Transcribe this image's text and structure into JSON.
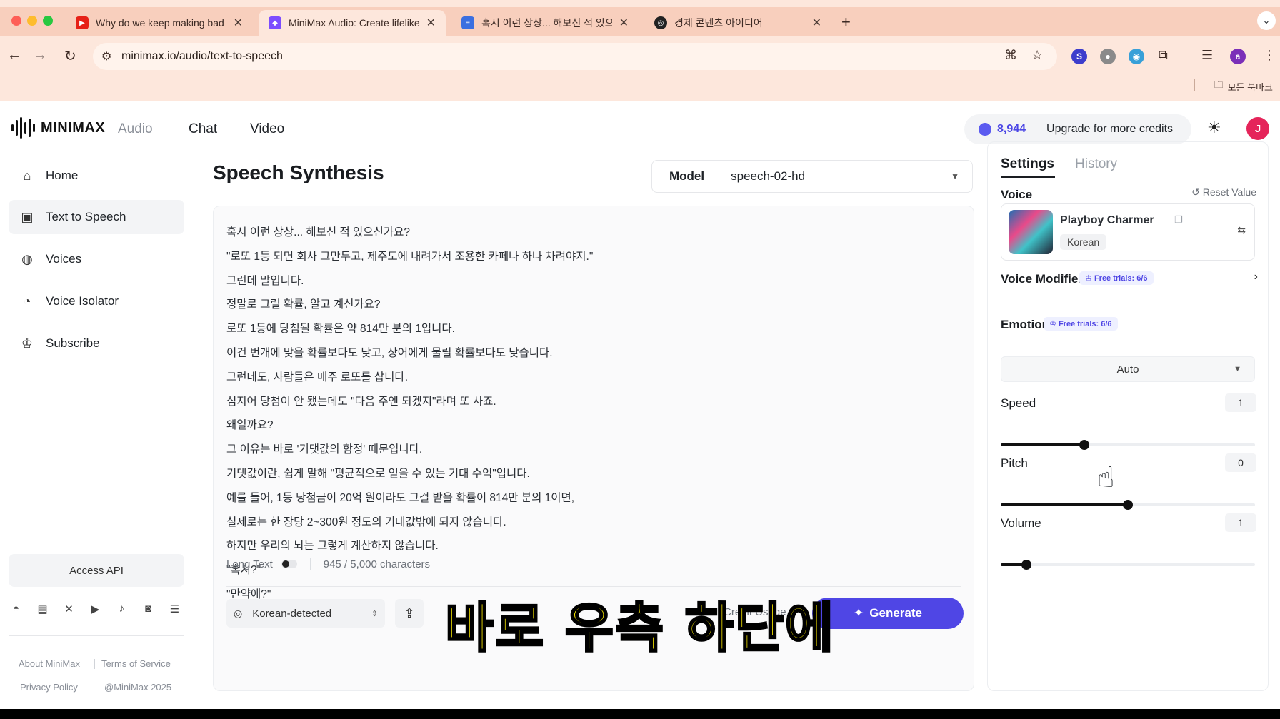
{
  "browser": {
    "tabs": [
      {
        "title": "Why do we keep making bad",
        "favicon_color": "#e62117"
      },
      {
        "title": "MiniMax Audio: Create lifelike",
        "favicon_color": "#7c4dff"
      },
      {
        "title": "혹시 이런 상상... 해보신 적 있으신가",
        "favicon_color": "#3b6fe0"
      },
      {
        "title": "경제 콘텐츠 아이디어",
        "favicon_color": "#222222"
      }
    ],
    "url": "minimax.io/audio/text-to-speech",
    "bookmarks_label": "모든 북마크",
    "profile_initial": "a"
  },
  "nav": {
    "brand": "MINIMAX",
    "links": [
      "Audio",
      "Chat",
      "Video"
    ],
    "credits": "8,944",
    "upgrade": "Upgrade for more credits",
    "avatar": "J"
  },
  "sidebar": {
    "items": [
      {
        "label": "Home",
        "icon": "home-icon"
      },
      {
        "label": "Text to Speech",
        "icon": "text-to-speech-icon"
      },
      {
        "label": "Voices",
        "icon": "voices-icon"
      },
      {
        "label": "Voice Isolator",
        "icon": "voice-isolator-icon"
      },
      {
        "label": "Subscribe",
        "icon": "crown-icon"
      }
    ],
    "access_api": "Access API",
    "footer": {
      "about": "About MiniMax",
      "terms": "Terms of Service",
      "privacy": "Privacy Policy",
      "copyright": "@MiniMax 2025"
    }
  },
  "main": {
    "title": "Speech Synthesis",
    "model_label": "Model",
    "model_value": "speech-02-hd",
    "lines": [
      "혹시 이런 상상... 해보신 적 있으신가요?",
      "\"로또 1등 되면 회사 그만두고, 제주도에 내려가서 조용한 카페나 하나 차려야지.\"",
      "그런데 말입니다.",
      " 정말로 그럴 확률, 알고 계신가요?",
      "로또 1등에 당첨될 확률은 약 814만 분의 1입니다.",
      " 이건 번개에 맞을 확률보다도 낮고, 상어에게 물릴 확률보다도 낮습니다.",
      "그런데도, 사람들은 매주 로또를 삽니다.",
      " 심지어 당첨이 안 됐는데도 \"다음 주엔 되겠지\"라며 또 사죠.",
      " 왜일까요?",
      "그 이유는 바로 '기댓값의 함정' 때문입니다.",
      "기댓값이란, 쉽게 말해 \"평균적으로 얻을 수 있는 기대 수익\"입니다.",
      " 예를 들어, 1등 당첨금이 20억 원이라도 그걸 받을 확률이 814만 분의 1이면,",
      " 실제로는 한 장당 2~300원 정도의 기대값밖에 되지 않습니다.",
      "하지만 우리의 뇌는 그렇게 계산하지 않습니다.",
      " \"혹시?\"",
      " \"만약에?\""
    ],
    "long_text_label": "Long Text",
    "char_count": "945 / 5,000 characters",
    "language": "Korean-detected",
    "credit_usage": "Credit Usage",
    "generate": "Generate"
  },
  "panel": {
    "tabs": [
      "Settings",
      "History"
    ],
    "voice_label": "Voice",
    "reset": "Reset Value",
    "voice_name": "Playboy Charmer",
    "voice_lang": "Korean",
    "modifier_label": "Voice Modifier",
    "modifier_trials": "Free trials: 6/6",
    "emotion_label": "Emotion",
    "emotion_trials": "Free trials: 6/6",
    "emotion_value": "Auto",
    "speed": {
      "label": "Speed",
      "value": "1",
      "fraction": 0.33
    },
    "pitch": {
      "label": "Pitch",
      "value": "0",
      "fraction": 0.5
    },
    "volume": {
      "label": "Volume",
      "value": "1",
      "fraction": 0.1
    }
  },
  "caption": "바로 우측 하단에"
}
